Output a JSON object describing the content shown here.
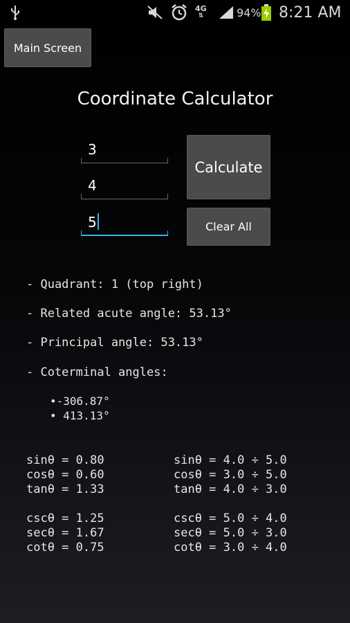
{
  "status_bar": {
    "icons": [
      "usb-icon",
      "mute-icon",
      "alarm-icon",
      "signal-icon",
      "battery-charging-icon"
    ],
    "network": "4G",
    "battery": "94%",
    "time": "8:21 AM"
  },
  "header": {
    "main_button": "Main Screen",
    "title": "Coordinate Calculator"
  },
  "inputs": {
    "x": "3",
    "y": "4",
    "r": "5"
  },
  "buttons": {
    "calculate": "Calculate",
    "clear": "Clear All"
  },
  "results": {
    "quadrant": "- Quadrant: 1 (top right)",
    "acute": "- Related acute angle: 53.13°",
    "principal": "- Principal angle: 53.13°",
    "coterminal_label": "- Coterminal angles:",
    "coterminal": [
      "•-306.87°",
      "• 413.13°"
    ]
  },
  "trig": {
    "values": [
      "sinθ = 0.80",
      "cosθ = 0.60",
      "tanθ = 1.33",
      "cscθ = 1.25",
      "secθ = 1.67",
      "cotθ = 0.75"
    ],
    "ratios": [
      "sinθ = 4.0 ÷ 5.0",
      "cosθ = 3.0 ÷ 5.0",
      "tanθ = 4.0 ÷ 3.0",
      "cscθ = 5.0 ÷ 4.0",
      "secθ = 5.0 ÷ 3.0",
      "cotθ = 3.0 ÷ 4.0"
    ]
  },
  "colors": {
    "accent": "#33b5e5",
    "button": "#4a4b4d"
  }
}
